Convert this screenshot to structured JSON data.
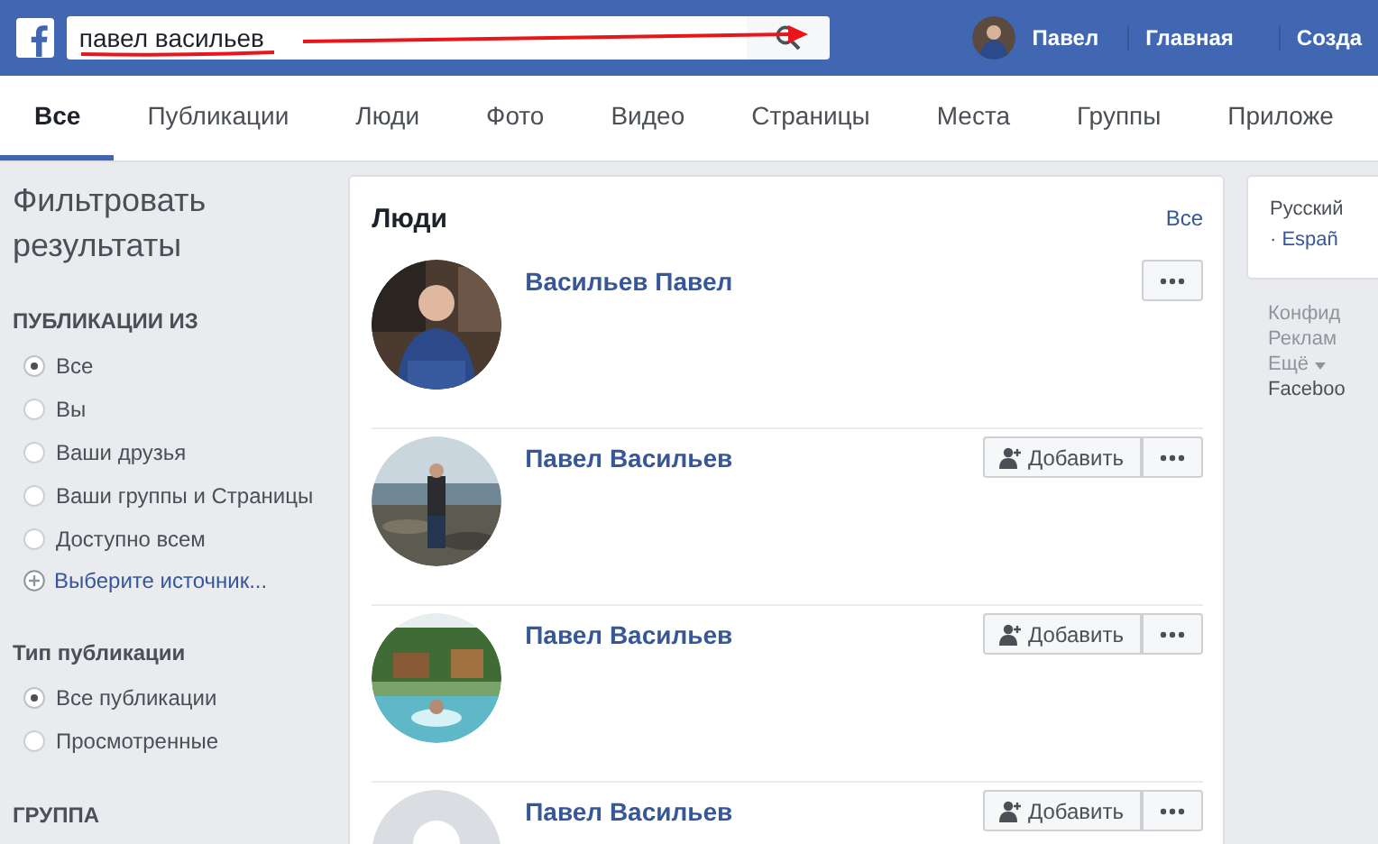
{
  "topbar": {
    "search": {
      "value": "павел васильев"
    },
    "user": "Павел",
    "links": [
      "Главная",
      "Созда"
    ]
  },
  "search_marks": {
    "underline": true,
    "arrow": true
  },
  "tabs": [
    {
      "label": "Все",
      "selected": true
    },
    {
      "label": "Публикации",
      "selected": false
    },
    {
      "label": "Люди",
      "selected": false
    },
    {
      "label": "Фото",
      "selected": false
    },
    {
      "label": "Видео",
      "selected": false
    },
    {
      "label": "Страницы",
      "selected": false
    },
    {
      "label": "Места",
      "selected": false
    },
    {
      "label": "Группы",
      "selected": false
    },
    {
      "label": "Приложе",
      "selected": false
    }
  ],
  "filters": {
    "title": "Фильтровать результаты",
    "sections": [
      {
        "heading": "ПУБЛИКАЦИИ ИЗ",
        "options": [
          {
            "label": "Все",
            "selected": true
          },
          {
            "label": "Вы",
            "selected": false
          },
          {
            "label": "Ваши друзья",
            "selected": false
          },
          {
            "label": "Ваши группы и Страницы",
            "selected": false
          },
          {
            "label": "Доступно всем",
            "selected": false
          }
        ],
        "more": "Выберите источник..."
      },
      {
        "heading": "Тип публикации",
        "options": [
          {
            "label": "Все публикации",
            "selected": true
          },
          {
            "label": "Просмотренные",
            "selected": false
          }
        ]
      },
      {
        "heading": "ГРУППА"
      }
    ]
  },
  "people": {
    "title": "Люди",
    "see_all": "Все",
    "rows": [
      {
        "name": "Васильев Павел",
        "add_button": null
      },
      {
        "name": "Павел Васильев",
        "add_button": "Добавить"
      },
      {
        "name": "Павел Васильев",
        "add_button": "Добавить"
      },
      {
        "name": "Павел Васильев",
        "avatar": {
          "kind": "default"
        },
        "add_button": "Добавить"
      }
    ]
  },
  "right": {
    "languages": [
      "Русский",
      "· Españ"
    ],
    "footer": [
      "Конфид",
      "Реклам",
      "Ещё",
      "Faceboo"
    ]
  }
}
